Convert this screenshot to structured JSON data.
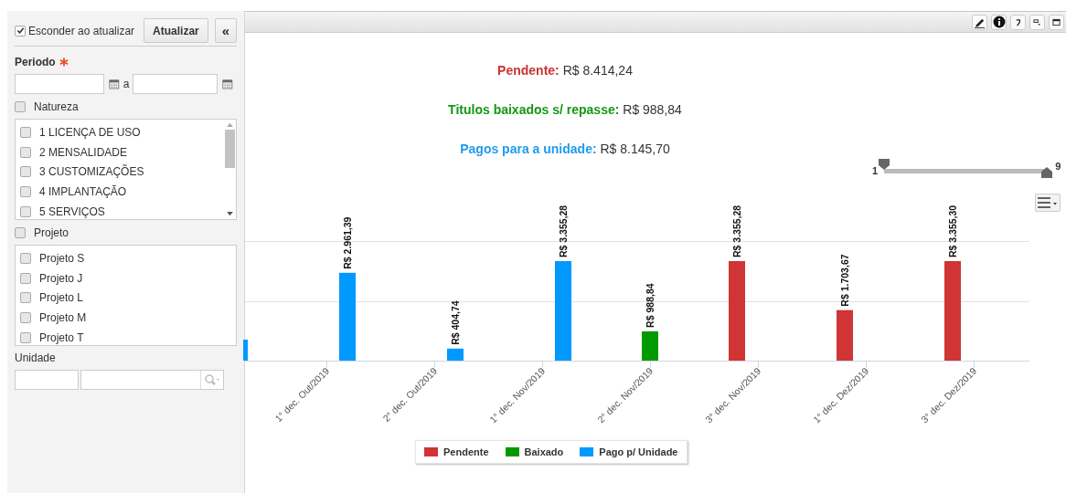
{
  "sidebar": {
    "hide_on_update": {
      "label": "Esconder ao atualizar",
      "checked": true
    },
    "update_button": "Atualizar",
    "collapse_button": "«",
    "period": {
      "label": "Periodo",
      "separator": "a"
    },
    "natureza": {
      "label": "Natureza",
      "checked": false,
      "items": [
        {
          "label": "1 LICENÇA DE USO",
          "checked": false
        },
        {
          "label": "2 MENSALIDADE",
          "checked": false
        },
        {
          "label": "3 CUSTOMIZAÇÕES",
          "checked": false
        },
        {
          "label": "4 IMPLANTAÇÃO",
          "checked": false
        },
        {
          "label": "5 SERVIÇOS",
          "checked": false
        }
      ]
    },
    "projeto": {
      "label": "Projeto",
      "checked": false,
      "items": [
        {
          "label": "Projeto S",
          "checked": false
        },
        {
          "label": "Projeto J",
          "checked": false
        },
        {
          "label": "Projeto L",
          "checked": false
        },
        {
          "label": "Projeto M",
          "checked": false
        },
        {
          "label": "Projeto T",
          "checked": false
        }
      ]
    },
    "unidade": {
      "label": "Unidade"
    }
  },
  "summary": [
    {
      "label": "Pendente:",
      "value": "R$ 8.414,24",
      "color": "#cc3333"
    },
    {
      "label": "Titulos baixados s/ repasse:",
      "value": "R$ 988,84",
      "color": "#119911"
    },
    {
      "label": "Pagos para a unidade:",
      "value": "R$ 8.145,70",
      "color": "#1e9bf0"
    }
  ],
  "range": {
    "min_label": "1",
    "max_label": "9",
    "start": {
      "level": 0
    },
    "end": {
      "level": 1
    }
  },
  "chart_data": {
    "type": "bar",
    "categories": [
      "1° dec. Out/2019",
      "2° dec. Out/2019",
      "1° dec. Nov/2019",
      "2° dec. Nov/2019",
      "3° dec. Nov/2019",
      "1° dec. Dez/2019",
      "3° dec. Dez/2019"
    ],
    "series": [
      {
        "name": "Pendente",
        "color": "#d03434",
        "values": [
          null,
          null,
          null,
          null,
          3355.28,
          1703.67,
          3355.3
        ],
        "value_labels": [
          null,
          null,
          null,
          null,
          "R$ 3.355,28",
          "R$ 1.703,67",
          "R$ 3.355,30"
        ]
      },
      {
        "name": "Baixado",
        "color": "#009a00",
        "values": [
          null,
          null,
          null,
          988.84,
          null,
          null,
          null
        ],
        "value_labels": [
          null,
          null,
          null,
          "R$ 988,84",
          null,
          null,
          null
        ]
      },
      {
        "name": "Pago p/ Unidade",
        "color": "#0099ff",
        "values": [
          2961.39,
          404.74,
          3355.28,
          null,
          null,
          null,
          null
        ],
        "value_labels": [
          "R$ 2.961,39",
          "R$ 404,74",
          "R$ 3.355,28",
          null,
          null,
          null,
          null
        ]
      }
    ],
    "data_labels": true
  }
}
